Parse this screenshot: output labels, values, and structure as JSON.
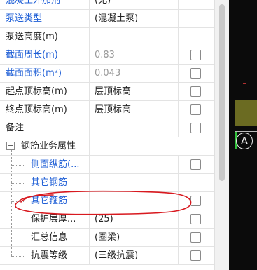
{
  "rows": [
    {
      "name": "混凝土外加剂",
      "value": "(无)",
      "name_style": "blue",
      "value_style": "",
      "has_checkbox": false
    },
    {
      "name": "泵送类型",
      "value": "(混凝土泵)",
      "name_style": "blue",
      "value_style": "",
      "has_checkbox": false
    },
    {
      "name": "泵送高度(m)",
      "value": "",
      "name_style": "",
      "value_style": "",
      "has_checkbox": false
    },
    {
      "name": "截面周长(m)",
      "value": "0.83",
      "name_style": "blue",
      "value_style": "gray",
      "has_checkbox": true
    },
    {
      "name": "截面面积(m²)",
      "value": "0.043",
      "name_style": "blue",
      "value_style": "gray",
      "has_checkbox": true
    },
    {
      "name": "起点顶标高(m)",
      "value": "层顶标高",
      "name_style": "",
      "value_style": "",
      "has_checkbox": true
    },
    {
      "name": "终点顶标高(m)",
      "value": "层顶标高",
      "name_style": "",
      "value_style": "",
      "has_checkbox": true
    },
    {
      "name": "备注",
      "value": "",
      "name_style": "",
      "value_style": "",
      "has_checkbox": true
    },
    {
      "name": "钢筋业务属性",
      "value": "",
      "name_style": "",
      "value_style": "",
      "has_checkbox": false,
      "group": true,
      "expander": "−"
    },
    {
      "name": "侧面纵筋(...",
      "value": "",
      "name_style": "blue",
      "value_style": "",
      "has_checkbox": true,
      "child": true
    },
    {
      "name": "其它钢筋",
      "value": "",
      "name_style": "blue",
      "value_style": "",
      "has_checkbox": false,
      "child": true
    },
    {
      "name": "其它箍筋",
      "value": "",
      "name_style": "blue",
      "value_style": "",
      "has_checkbox": true,
      "child": true
    },
    {
      "name": "保护层厚...",
      "value": "(25)",
      "name_style": "",
      "value_style": "",
      "has_checkbox": true,
      "child": true
    },
    {
      "name": "汇总信息",
      "value": "(圈梁)",
      "name_style": "",
      "value_style": "",
      "has_checkbox": true,
      "child": true
    },
    {
      "name": "抗震等级",
      "value": "(三级抗震)",
      "name_style": "",
      "value_style": "",
      "has_checkbox": true,
      "child": true
    }
  ],
  "viewport": {
    "axis_label": "A"
  },
  "colors": {
    "blue_text": "#1f5fd6",
    "annotation": "#d8191f",
    "viewport_bg": "#0b0b0b"
  }
}
